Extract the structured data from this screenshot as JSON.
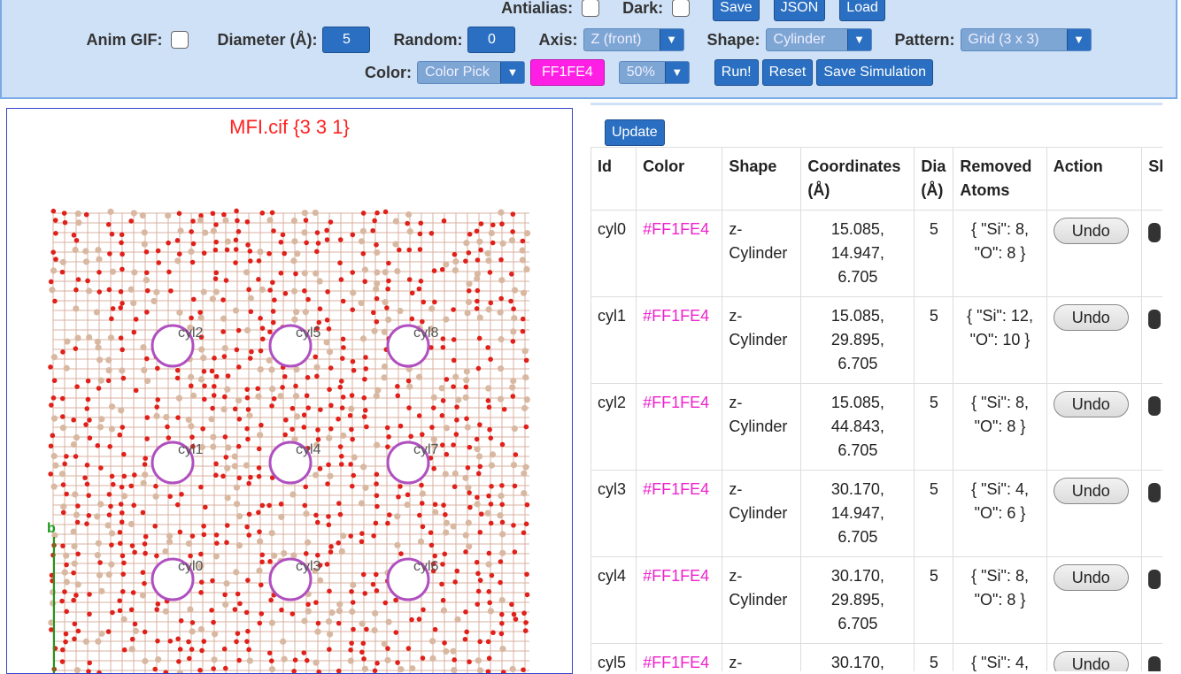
{
  "toolbar": {
    "row0": [
      {
        "id": "antialias",
        "label": "Antialias:"
      },
      {
        "id": "dark",
        "label": "Dark:"
      }
    ],
    "row0_buttons": [
      "Save",
      "JSON",
      "Load"
    ],
    "anim_gif_label": "Anim GIF:",
    "diameter_label": "Diameter (Å):",
    "diameter_value": "5",
    "random_label": "Random:",
    "random_value": "0",
    "axis_label": "Axis:",
    "axis_value": "Z (front)",
    "shape_label": "Shape:",
    "shape_value": "Cylinder",
    "pattern_label": "Pattern:",
    "pattern_value": "Grid (3 x 3)",
    "color_label": "Color:",
    "color_mode_value": "Color Pick",
    "color_hex": "FF1FE4",
    "opacity_value": "50%",
    "run_label": "Run!",
    "reset_label": "Reset",
    "save_sim_label": "Save Simulation"
  },
  "viewer": {
    "title": "MFI.cif {3 3 1}",
    "axis_label": "b",
    "cylinders": [
      "cyl2",
      "cyl5",
      "cyl8",
      "cyl1",
      "cyl4",
      "cyl7",
      "cyl0",
      "cyl3",
      "cyl6"
    ]
  },
  "panel": {
    "update_label": "Update",
    "headers": [
      "Id",
      "Color",
      "Shape",
      "Coordinates (Å)",
      "Dia (Å)",
      "Removed Atoms",
      "Action",
      "Sha"
    ],
    "undo_label": "Undo",
    "rows": [
      {
        "id": "cyl0",
        "color": "#FF1FE4",
        "shape": "z-Cylinder",
        "coords": [
          "15.085,",
          "14.947,",
          "6.705"
        ],
        "dia": "5",
        "removed": "{ \"Si\": 8, \"O\": 8 }"
      },
      {
        "id": "cyl1",
        "color": "#FF1FE4",
        "shape": "z-Cylinder",
        "coords": [
          "15.085,",
          "29.895,",
          "6.705"
        ],
        "dia": "5",
        "removed": "{ \"Si\": 12, \"O\": 10 }"
      },
      {
        "id": "cyl2",
        "color": "#FF1FE4",
        "shape": "z-Cylinder",
        "coords": [
          "15.085,",
          "44.843,",
          "6.705"
        ],
        "dia": "5",
        "removed": "{ \"Si\": 8, \"O\": 8 }"
      },
      {
        "id": "cyl3",
        "color": "#FF1FE4",
        "shape": "z-Cylinder",
        "coords": [
          "30.170,",
          "14.947,",
          "6.705"
        ],
        "dia": "5",
        "removed": "{ \"Si\": 4, \"O\": 6 }"
      },
      {
        "id": "cyl4",
        "color": "#FF1FE4",
        "shape": "z-Cylinder",
        "coords": [
          "30.170,",
          "29.895,",
          "6.705"
        ],
        "dia": "5",
        "removed": "{ \"Si\": 8, \"O\": 8 }"
      },
      {
        "id": "cyl5",
        "color": "#FF1FE4",
        "shape": "z-",
        "coords": [
          "30.170,",
          "",
          ""
        ],
        "dia": "5",
        "removed": "{ \"Si\": 4,"
      }
    ]
  }
}
